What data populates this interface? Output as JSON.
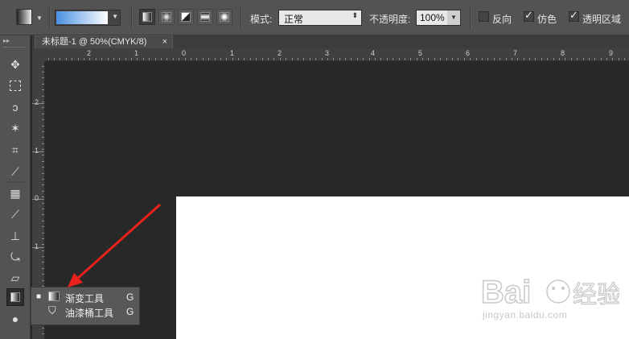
{
  "options_bar": {
    "mode_label": "模式:",
    "mode_value": "正常",
    "opacity_label": "不透明度:",
    "opacity_value": "100%",
    "reverse_label": "反向",
    "reverse_checked": false,
    "dither_label": "仿色",
    "dither_checked": true,
    "transparency_label": "透明区域",
    "transparency_checked": true,
    "gradient_colors": [
      "#4a90e2",
      "#ffffff"
    ]
  },
  "document_tab": {
    "title": "未标题-1 @ 50%(CMYK/8)",
    "close_glyph": "×"
  },
  "rulers": {
    "horizontal": [
      "2",
      "1",
      "0",
      "1",
      "2",
      "3",
      "4",
      "5",
      "6",
      "7",
      "8",
      "9"
    ],
    "vertical": [
      "2",
      "1",
      "0",
      "1"
    ]
  },
  "tool_flyout": {
    "items": [
      {
        "label": "渐变工具",
        "shortcut": "G",
        "active": true,
        "marker": "■"
      },
      {
        "label": "油漆桶工具",
        "shortcut": "G",
        "active": false,
        "marker": ""
      }
    ]
  },
  "watermark": {
    "text": "Bai经验",
    "url": "jingyan.baidu.com"
  },
  "colors": {
    "panel": "#535353",
    "canvas_bg": "#282828",
    "arrow": "#e8211c"
  }
}
